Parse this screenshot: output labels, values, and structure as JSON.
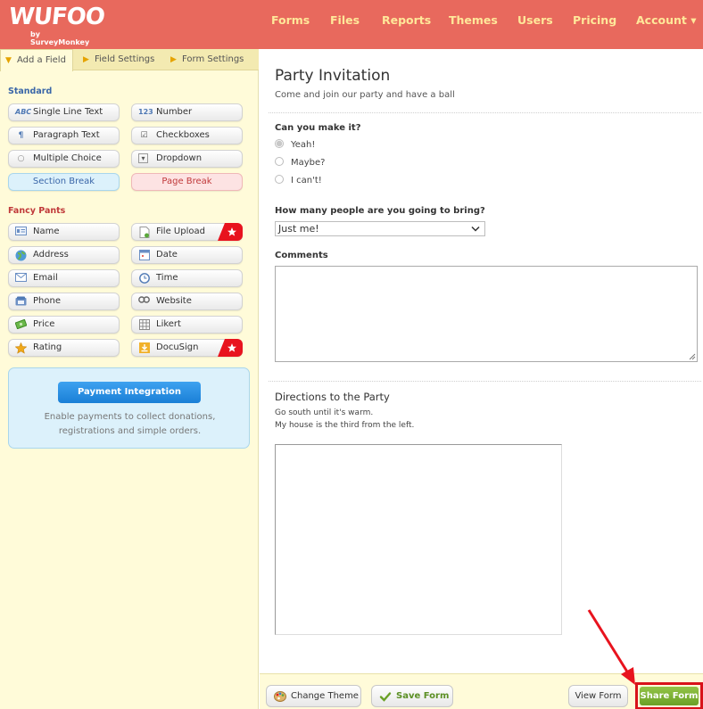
{
  "header": {
    "logo_main": "WUFOO",
    "logo_sub": "by SurveyMonkey",
    "nav": [
      "Forms",
      "Files",
      "Reports",
      "Themes",
      "Users",
      "Pricing",
      "Account ▾"
    ]
  },
  "left_panel": {
    "tabs": [
      "Add a Field",
      "Field Settings",
      "Form Settings"
    ],
    "standard_label": "Standard",
    "standard": [
      {
        "label": "Single Line Text",
        "icon": "abc-icon"
      },
      {
        "label": "Number",
        "icon": "number-icon"
      },
      {
        "label": "Paragraph Text",
        "icon": "paragraph-icon"
      },
      {
        "label": "Checkboxes",
        "icon": "checkbox-icon"
      },
      {
        "label": "Multiple Choice",
        "icon": "radio-icon"
      },
      {
        "label": "Dropdown",
        "icon": "dropdown-icon"
      }
    ],
    "section_break": "Section Break",
    "page_break": "Page Break",
    "fancy_label": "Fancy Pants",
    "fancy": [
      {
        "label": "Name",
        "icon": "name-card-icon"
      },
      {
        "label": "File Upload",
        "icon": "file-upload-icon",
        "premium": true
      },
      {
        "label": "Address",
        "icon": "globe-icon"
      },
      {
        "label": "Date",
        "icon": "calendar-icon"
      },
      {
        "label": "Email",
        "icon": "envelope-icon"
      },
      {
        "label": "Time",
        "icon": "clock-icon"
      },
      {
        "label": "Phone",
        "icon": "phone-icon"
      },
      {
        "label": "Website",
        "icon": "link-icon"
      },
      {
        "label": "Price",
        "icon": "money-icon"
      },
      {
        "label": "Likert",
        "icon": "likert-icon"
      },
      {
        "label": "Rating",
        "icon": "star-icon"
      },
      {
        "label": "DocuSign",
        "icon": "docusign-icon",
        "premium": true
      }
    ],
    "payment": {
      "button": "Payment Integration",
      "text_line1": "Enable payments to collect donations,",
      "text_line2": "registrations and simple orders."
    }
  },
  "form": {
    "title": "Party Invitation",
    "description": "Come and join our party and have a ball",
    "q1": {
      "label": "Can you make it?",
      "options": [
        "Yeah!",
        "Maybe?",
        "I can't!"
      ],
      "selected": 0
    },
    "q2": {
      "label": "How many people are you going to bring?",
      "value": "Just me!"
    },
    "q3": {
      "label": "Comments"
    },
    "directions": {
      "title": "Directions to the Party",
      "line1": "Go south until it's warm.",
      "line2": "My house is the third from the left."
    }
  },
  "bottom_bar": {
    "change_theme": "Change Theme",
    "save_form": "Save Form",
    "view_form": "View Form",
    "share_form": "Share Form"
  },
  "colors": {
    "header_bg": "#e8695d",
    "nav_text": "#ffe89a",
    "panel_bg": "#fffbd9",
    "highlight": "#d8121a",
    "share_green": "#7bb134"
  }
}
